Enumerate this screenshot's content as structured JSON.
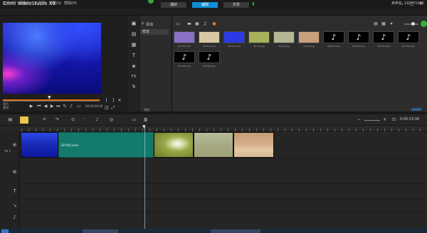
{
  "window": {
    "title": "Corel VideoStudio X9",
    "controls": [
      "–",
      "□",
      "✕"
    ]
  },
  "steps": {
    "capture": "捕获",
    "edit": "编辑",
    "share": "共享"
  },
  "menu": {
    "items": [
      "文件(F)",
      "编辑(E)",
      "工具(T)",
      "设置(S)",
      "帮助(H)"
    ],
    "project_time": "未命名, 1920*1080"
  },
  "player": {
    "mode_project": "项目",
    "mode_clip": "素材",
    "timecode": "00:00:09:00"
  },
  "library": {
    "add_label": "添加",
    "folder": "样本",
    "browse": "浏览"
  },
  "media": {
    "items": [
      {
        "label": "SP-V01.mp4",
        "type": "video",
        "color": "#8a6fc7"
      },
      {
        "label": "SP-V02.mp4",
        "type": "video",
        "color": "#d9c8a6"
      },
      {
        "label": "SP-V03.mp4",
        "type": "video",
        "color": "#2a3ae6"
      },
      {
        "label": "SP-I01.jpg",
        "type": "image",
        "color": "#a9b15a"
      },
      {
        "label": "SP-I02.jpg",
        "type": "image",
        "color": "#b6b693"
      },
      {
        "label": "SP-I03.jpg",
        "type": "image",
        "color": "#c9a07a"
      },
      {
        "label": "SP-S01.mpa",
        "type": "audio",
        "color": "#000000"
      },
      {
        "label": "SP-S02.mpa",
        "type": "audio",
        "color": "#000000"
      },
      {
        "label": "SP-S03.mpa",
        "type": "audio",
        "color": "#000000"
      },
      {
        "label": "SP-S04.mpa",
        "type": "audio",
        "color": "#000000"
      },
      {
        "label": "SP-S05.mpa",
        "type": "audio",
        "color": "#000000"
      },
      {
        "label": "SP-S06.mpa",
        "type": "audio",
        "color": "#000000"
      }
    ]
  },
  "timeline": {
    "duration": "0:00:15:00",
    "title_clip_text": "SP-V04.wmv",
    "track_label": "Vd 1"
  }
}
